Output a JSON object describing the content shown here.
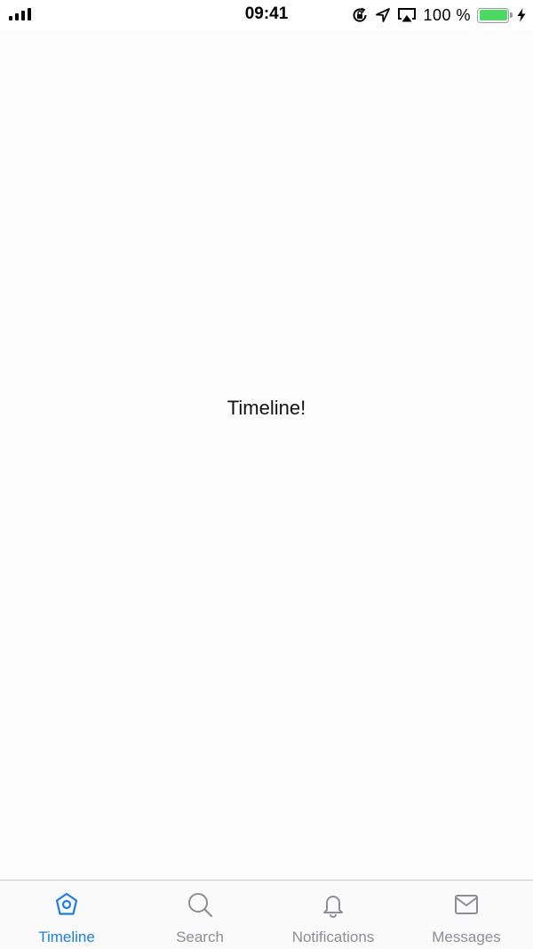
{
  "status_bar": {
    "time": "09:41",
    "battery_percent": "100 %",
    "battery_level": 1.0,
    "battery_color": "#4cd964",
    "icons": [
      "signal-icon",
      "orientation-lock-icon",
      "location-icon",
      "airplay-icon",
      "battery-icon",
      "charging-icon"
    ]
  },
  "main": {
    "text": "Timeline!"
  },
  "tab_bar": {
    "active_color": "#1e7fd8",
    "inactive_color": "#8e8e93",
    "tabs": [
      {
        "label": "Timeline",
        "icon": "home-icon",
        "active": true
      },
      {
        "label": "Search",
        "icon": "search-icon",
        "active": false
      },
      {
        "label": "Notifications",
        "icon": "bell-icon",
        "active": false
      },
      {
        "label": "Messages",
        "icon": "mail-icon",
        "active": false
      }
    ]
  }
}
